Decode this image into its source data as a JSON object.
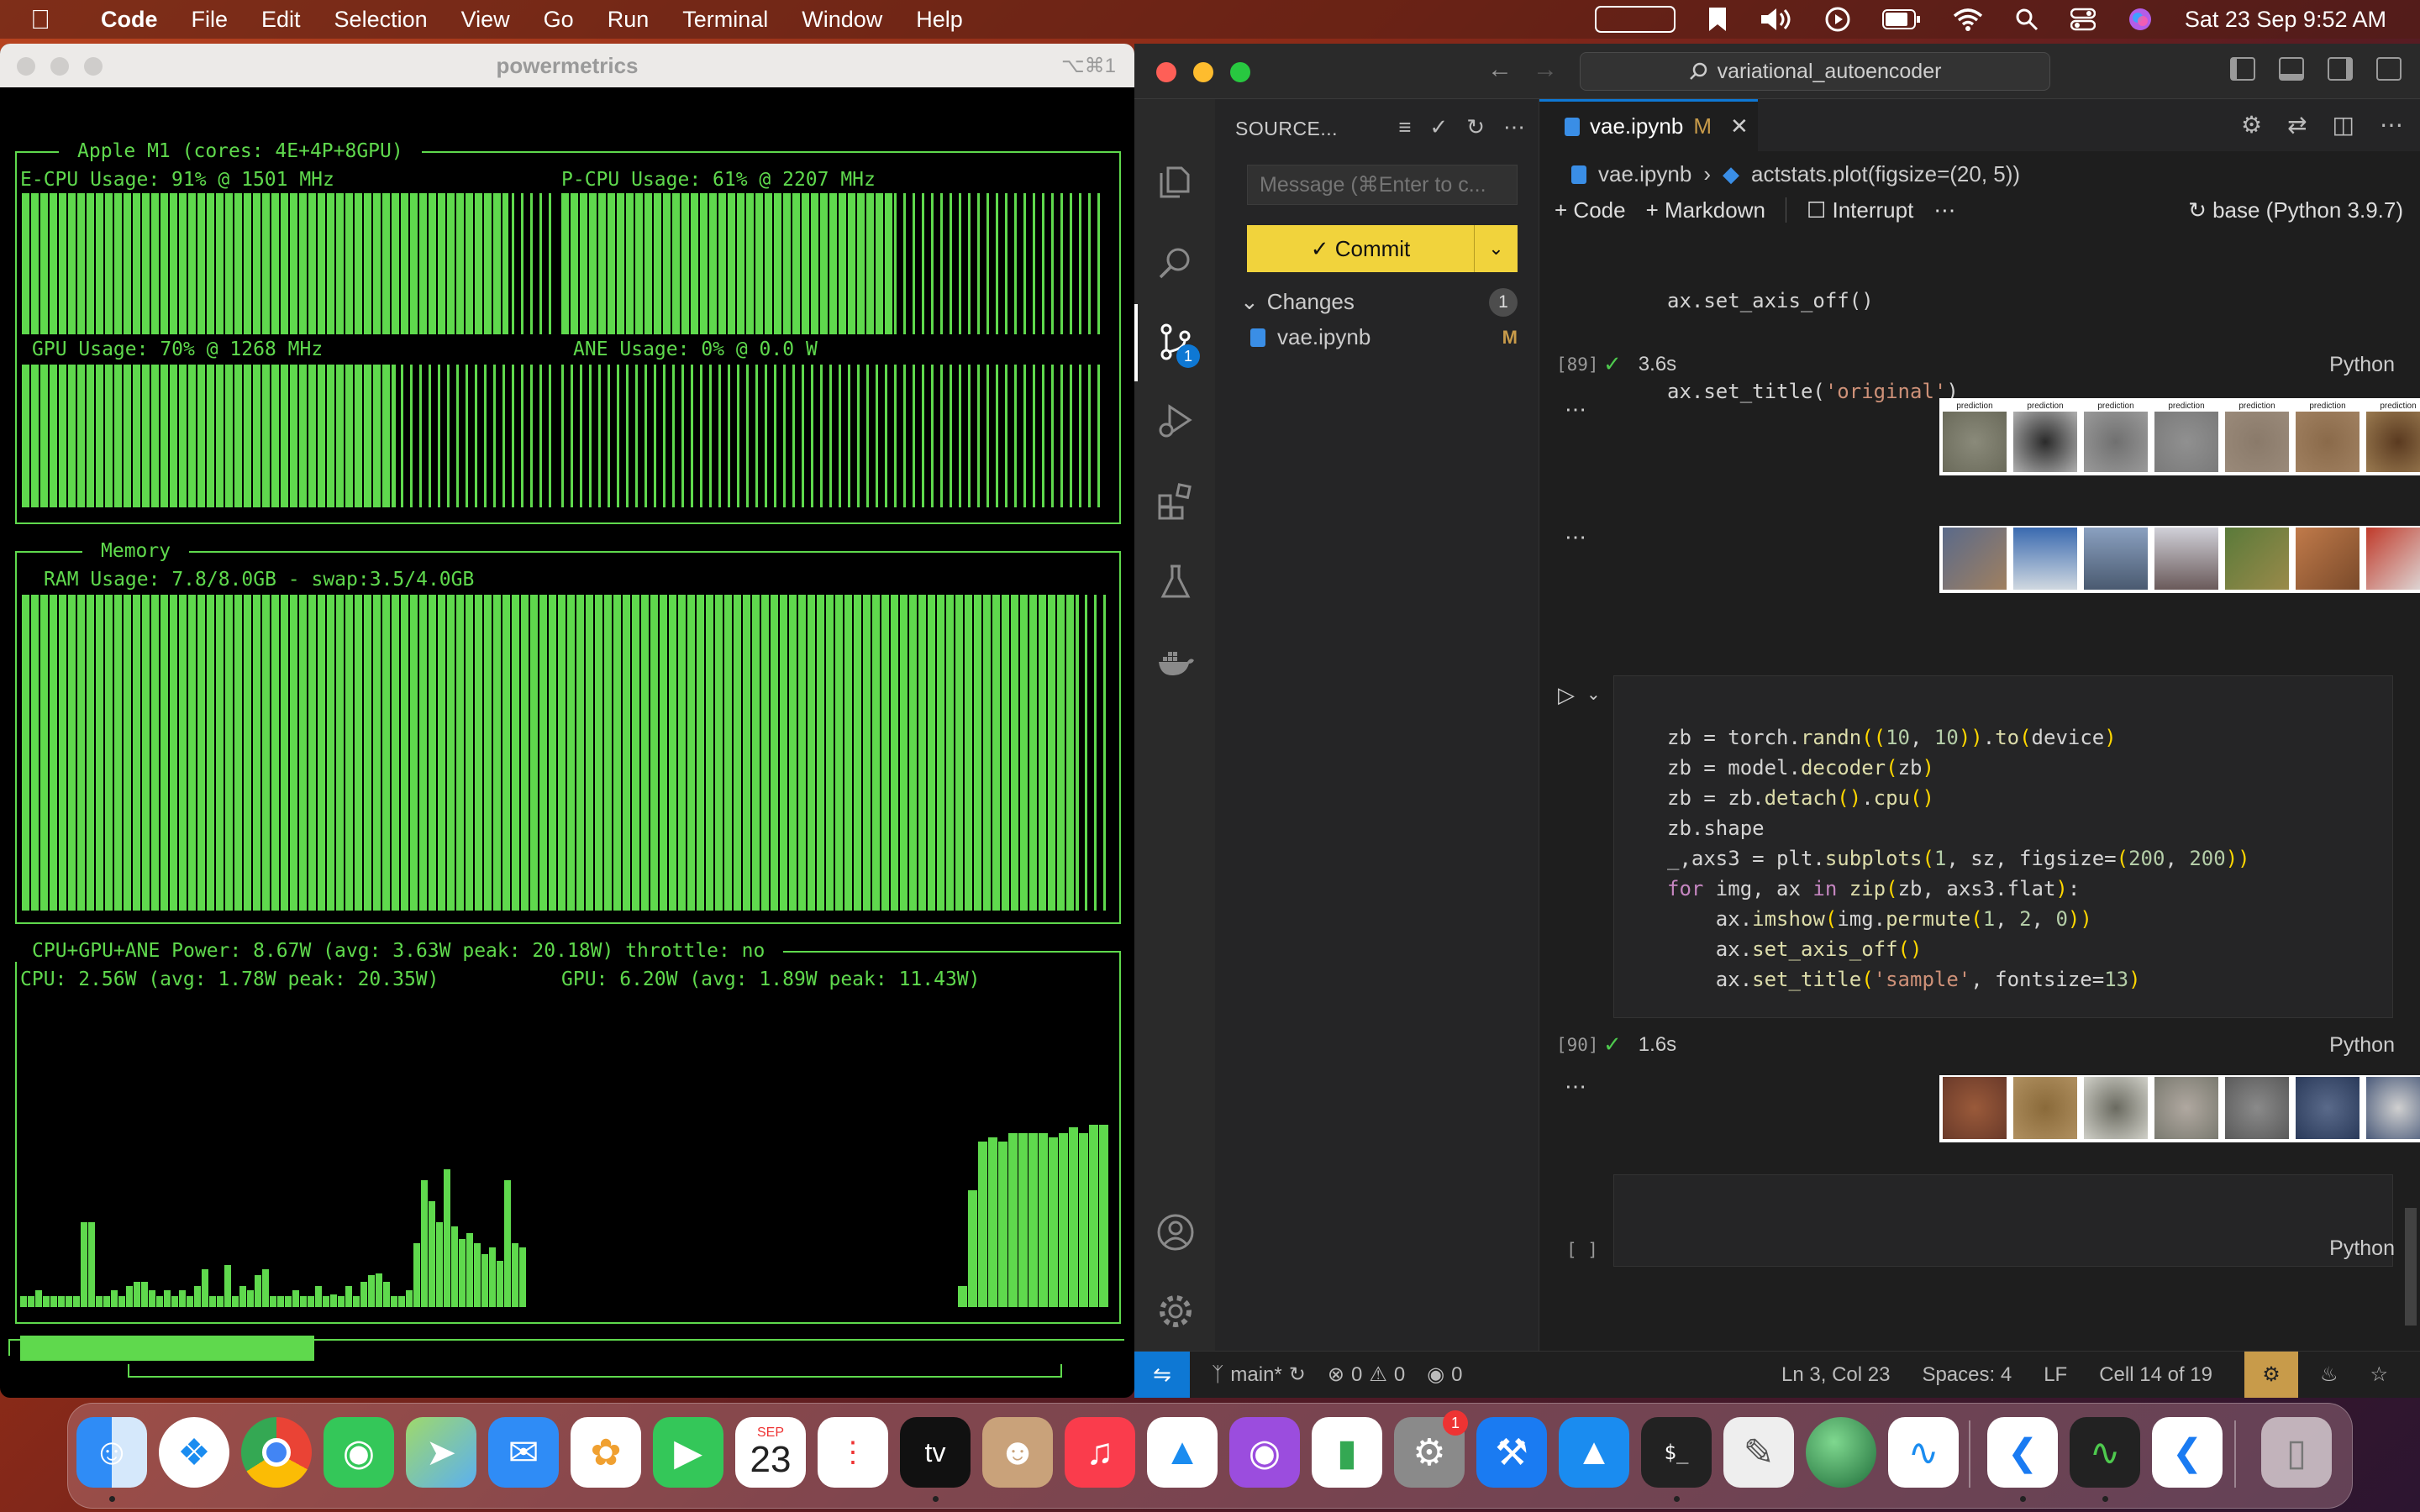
{
  "menubar": {
    "app_name": "Code",
    "items": [
      "File",
      "Edit",
      "Selection",
      "View",
      "Go",
      "Run",
      "Terminal",
      "Window",
      "Help"
    ],
    "clock": "Sat 23 Sep  9:52 AM"
  },
  "powermetrics": {
    "window_title": "powermetrics",
    "shortcut": "⌥⌘1",
    "cpu_box_title": "Apple M1 (cores: 4E+4P+8GPU)",
    "ecpu_label": "E-CPU Usage: 91% @ 1501 MHz",
    "ecpu_fill": 0.91,
    "pcpu_label": "P-CPU Usage: 61% @ 2207 MHz",
    "pcpu_fill": 0.61,
    "gpu_label": "GPU Usage: 70% @ 1268 MHz",
    "gpu_fill": 0.7,
    "ane_label": "ANE Usage: 0% @ 0.0 W",
    "ane_fill": 0.0,
    "memory_title": "Memory",
    "ram_label": "RAM Usage: 7.8/8.0GB - swap:3.5/4.0GB",
    "ram_fill": 0.975,
    "power_title": "CPU+GPU+ANE Power: 8.67W (avg: 3.63W peak: 20.18W) throttle: no",
    "cpu_power_label": "CPU: 2.56W (avg: 1.78W peak: 20.35W)",
    "gpu_power_label": "GPU: 6.20W (avg: 1.89W peak: 11.43W)",
    "cpu_power_history": [
      0.05,
      0.05,
      0.08,
      0.05,
      0.05,
      0.05,
      0.05,
      0.05,
      0.4,
      0.4,
      0.05,
      0.05,
      0.08,
      0.05,
      0.1,
      0.12,
      0.12,
      0.08,
      0.05,
      0.08,
      0.05,
      0.08,
      0.05,
      0.1,
      0.18,
      0.05,
      0.05,
      0.2,
      0.05,
      0.1,
      0.08,
      0.15,
      0.18,
      0.05,
      0.05,
      0.05,
      0.08,
      0.05,
      0.05,
      0.1,
      0.05,
      0.06,
      0.05,
      0.1,
      0.05,
      0.12,
      0.15,
      0.16,
      0.12,
      0.05,
      0.05,
      0.08,
      0.3,
      0.6,
      0.5,
      0.4,
      0.65,
      0.38,
      0.32,
      0.35,
      0.3,
      0.25,
      0.28,
      0.22,
      0.6,
      0.3,
      0.28
    ],
    "gpu_power_history": [
      0.1,
      0.55,
      0.78,
      0.8,
      0.78,
      0.82,
      0.82,
      0.82,
      0.82,
      0.8,
      0.82,
      0.85,
      0.82,
      0.86,
      0.86
    ]
  },
  "vscode": {
    "search_text": "variational_autoencoder",
    "sidebar": {
      "header": "SOURCE...",
      "message_placeholder": "Message (⌘Enter to c...",
      "commit_label": "✓ Commit",
      "changes_label": "Changes",
      "changes_count": "1",
      "file_name": "vae.ipynb",
      "file_status": "M"
    },
    "activity_badge": "1",
    "tab": {
      "name": "vae.ipynb",
      "modified": "M"
    },
    "breadcrumb": {
      "file": "vae.ipynb",
      "symbol": "actstats.plot(figsize=(20, 5))"
    },
    "toolbar": {
      "code": "Code",
      "markdown": "Markdown",
      "interrupt": "Interrupt",
      "kernel": "base (Python 3.9.7)"
    },
    "cell89": {
      "line1": "ax.set_axis_off()",
      "line2_pre": "ax.set_title(",
      "line2_str": "'original'",
      "line2_post": ")",
      "exec": "[89]",
      "time": "3.6s",
      "lang": "Python",
      "prediction_caption": "prediction"
    },
    "cell90": {
      "exec": "[90]",
      "time": "1.6s",
      "lang": "Python"
    },
    "empty_cell": {
      "exec": "[ ]",
      "lang": "Python"
    },
    "statusbar": {
      "branch": "main*",
      "errors": "0",
      "warnings": "0",
      "ports": "0",
      "position": "Ln 3, Col 23",
      "spaces": "Spaces: 4",
      "eol": "LF",
      "cell": "Cell 14 of 19"
    }
  },
  "colors": {
    "terminal_green": "#5fd94d",
    "vscode_blue": "#0e78d4",
    "commit_yellow": "#f1d33c"
  },
  "dock": {
    "calendar_month": "SEP",
    "calendar_day": "23",
    "settings_badge": "1",
    "tv_label": "tv"
  }
}
